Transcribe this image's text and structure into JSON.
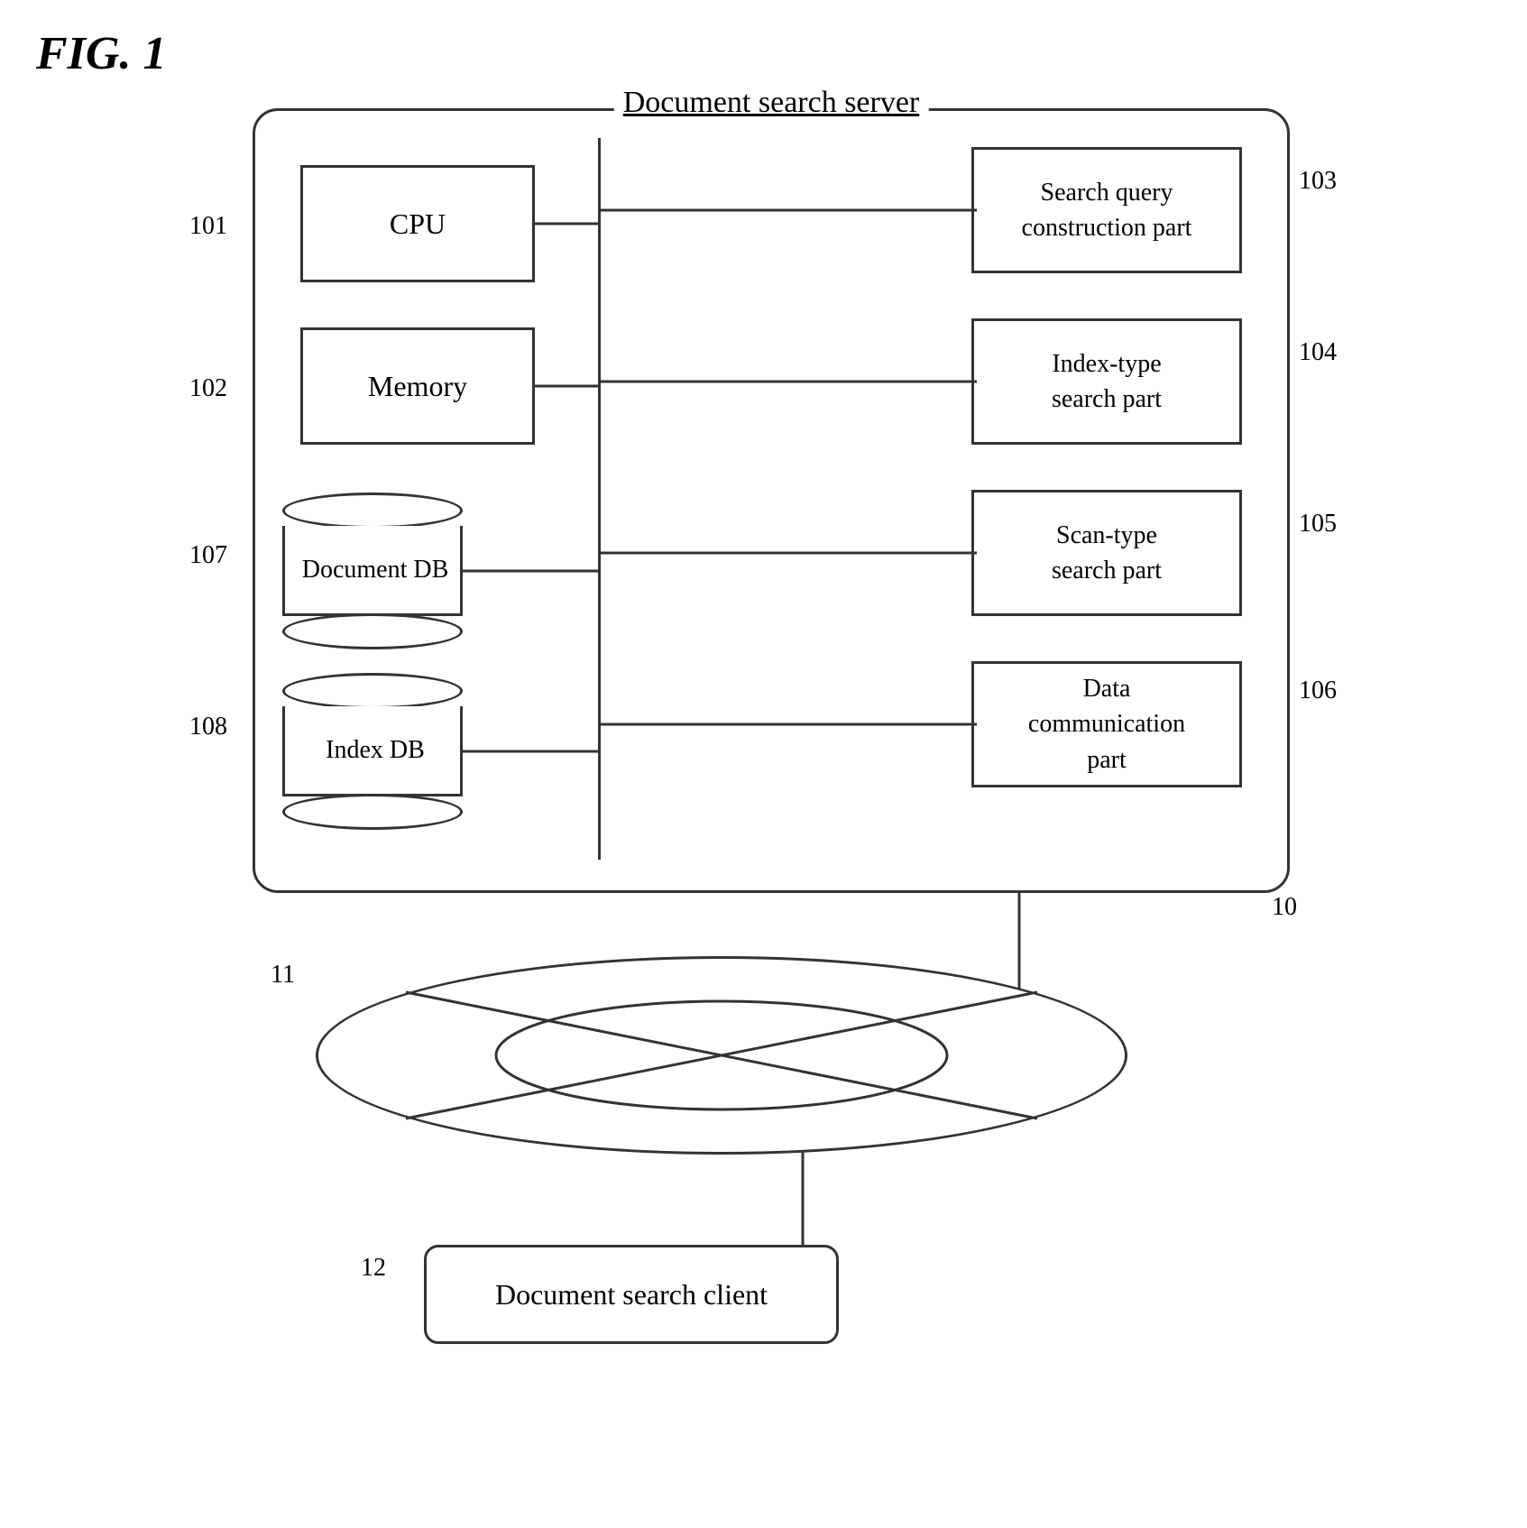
{
  "figure": {
    "label": "FIG. 1"
  },
  "server": {
    "title": "Document search server",
    "ref": "10",
    "components": {
      "cpu": {
        "label": "CPU",
        "ref": "101"
      },
      "memory": {
        "label": "Memory",
        "ref": "102"
      },
      "document_db": {
        "label": "Document DB",
        "ref": "107"
      },
      "index_db": {
        "label": "Index DB",
        "ref": "108"
      },
      "search_query": {
        "label": "Search query\nconstruction part",
        "ref": "103"
      },
      "index_type": {
        "label": "Index-type\nsearch part",
        "ref": "104"
      },
      "scan_type": {
        "label": "Scan-type\nsearch part",
        "ref": "105"
      },
      "data_comm": {
        "label": "Data\ncommunication\npart",
        "ref": "106"
      }
    }
  },
  "network": {
    "ref": "11"
  },
  "client": {
    "label": "Document search client",
    "ref": "12"
  }
}
